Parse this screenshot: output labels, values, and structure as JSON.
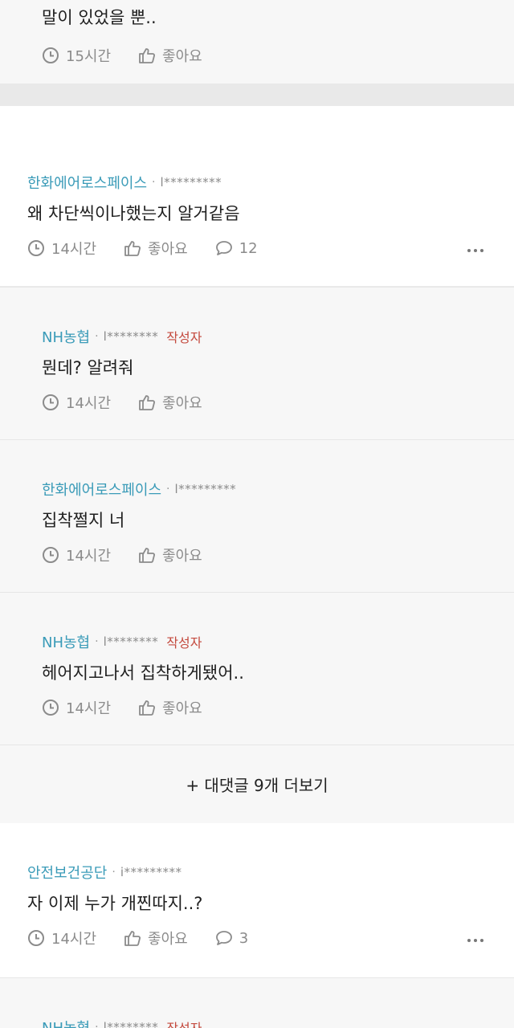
{
  "top_reply": {
    "text": "말이 있었을 뿐..",
    "time": "15시간",
    "like": "좋아요"
  },
  "comment1": {
    "company": "한화에어로스페이스",
    "uid": "l*********",
    "text": "왜 차단씩이나했는지 알거같음",
    "time": "14시간",
    "like": "좋아요",
    "reply_count": "12"
  },
  "reply1": {
    "company": "NH농협",
    "uid": "l********",
    "author": "작성자",
    "text": "뭔데? 알려줘",
    "time": "14시간",
    "like": "좋아요"
  },
  "reply2": {
    "company": "한화에어로스페이스",
    "uid": "l*********",
    "text": "집착쩔지 너",
    "time": "14시간",
    "like": "좋아요"
  },
  "reply3": {
    "company": "NH농협",
    "uid": "l********",
    "author": "작성자",
    "text": "헤어지고나서 집착하게됐어..",
    "time": "14시간",
    "like": "좋아요"
  },
  "load_more": "+ 대댓글 9개 더보기",
  "comment2": {
    "company": "안전보건공단",
    "uid": "i*********",
    "text": "자 이제 누가 개찐따지..?",
    "time": "14시간",
    "like": "좋아요",
    "reply_count": "3"
  },
  "bottom_reply": {
    "company": "NH농협",
    "uid": "l********",
    "author": "작성자"
  },
  "icons": {
    "time": "clock-icon",
    "like": "thumbs-up-icon",
    "reply": "speech-bubble-icon",
    "more": "more-icon"
  }
}
